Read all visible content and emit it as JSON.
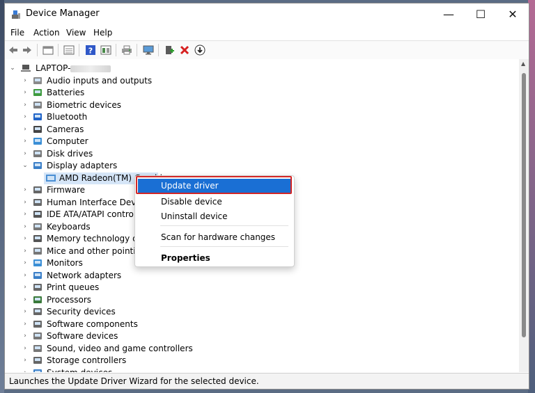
{
  "window": {
    "title": "Device Manager",
    "controls": {
      "minimize": "—",
      "maximize": "☐",
      "close": "✕"
    }
  },
  "menu": [
    "File",
    "Action",
    "View",
    "Help"
  ],
  "toolbar": {
    "icons": [
      "back-arrow-icon",
      "forward-arrow-icon",
      "properties-icon",
      "console-tree-icon",
      "help-icon",
      "view-icon",
      "print-icon",
      "monitor-icon",
      "add-driver-icon",
      "delete-icon",
      "download-icon"
    ]
  },
  "tree": {
    "root": {
      "label": "LAPTOP-"
    },
    "categories": [
      {
        "label": "Audio inputs and outputs",
        "icon": "speaker-icon"
      },
      {
        "label": "Batteries",
        "icon": "battery-icon"
      },
      {
        "label": "Biometric devices",
        "icon": "fingerprint-icon"
      },
      {
        "label": "Bluetooth",
        "icon": "bluetooth-icon"
      },
      {
        "label": "Cameras",
        "icon": "camera-icon"
      },
      {
        "label": "Computer",
        "icon": "computer-icon"
      },
      {
        "label": "Disk drives",
        "icon": "disk-drive-icon"
      },
      {
        "label": "Display adapters",
        "icon": "display-adapter-icon"
      },
      {
        "label": "Firmware",
        "icon": "firmware-icon"
      },
      {
        "label": "Human Interface Devices",
        "icon": "hid-icon"
      },
      {
        "label": "IDE ATA/ATAPI controllers",
        "icon": "ide-controller-icon"
      },
      {
        "label": "Keyboards",
        "icon": "keyboard-icon"
      },
      {
        "label": "Memory technology devi",
        "icon": "memory-icon"
      },
      {
        "label": "Mice and other pointing",
        "icon": "mouse-icon"
      },
      {
        "label": "Monitors",
        "icon": "monitor-icon"
      },
      {
        "label": "Network adapters",
        "icon": "network-icon"
      },
      {
        "label": "Print queues",
        "icon": "printer-icon"
      },
      {
        "label": "Processors",
        "icon": "processor-icon"
      },
      {
        "label": "Security devices",
        "icon": "security-icon"
      },
      {
        "label": "Software components",
        "icon": "software-component-icon"
      },
      {
        "label": "Software devices",
        "icon": "software-device-icon"
      },
      {
        "label": "Sound, video and game controllers",
        "icon": "sound-icon"
      },
      {
        "label": "Storage controllers",
        "icon": "storage-icon"
      },
      {
        "label": "System devices",
        "icon": "system-icon"
      }
    ],
    "display_child": {
      "label": "AMD Radeon(TM) Graphi"
    }
  },
  "context_menu": {
    "update": "Update driver",
    "disable": "Disable device",
    "uninstall": "Uninstall device",
    "scan": "Scan for hardware changes",
    "properties": "Properties"
  },
  "status": "Launches the Update Driver Wizard for the selected device.",
  "colors": {
    "highlight": "#1a6fd4",
    "annotation": "#d32626"
  }
}
